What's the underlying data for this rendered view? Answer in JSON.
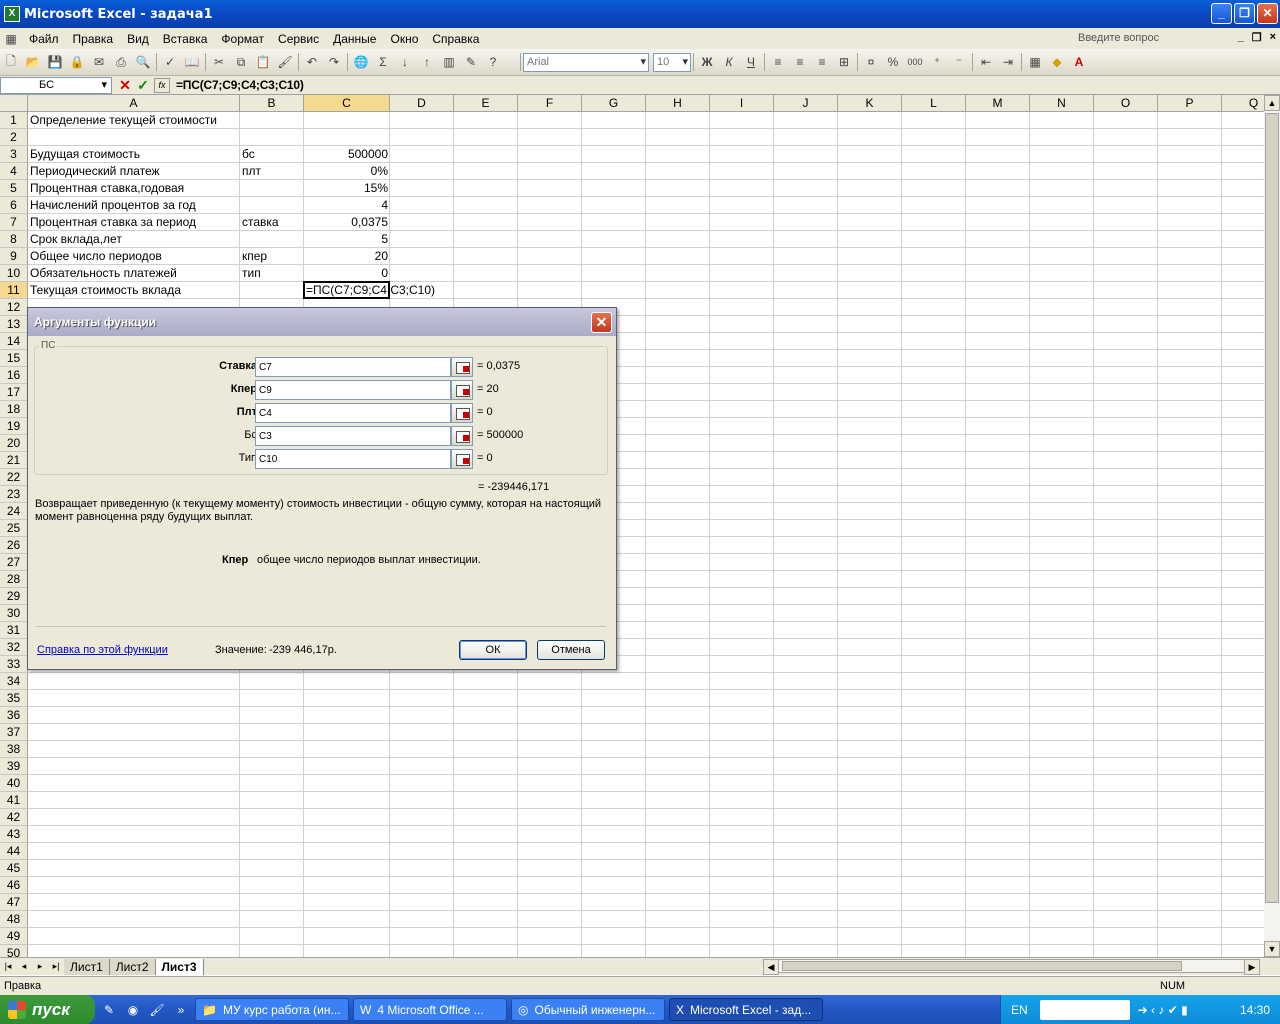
{
  "window": {
    "title": "Microsoft Excel - задача1",
    "minimize": "_",
    "maximize": "❐",
    "close": "✕"
  },
  "menu": {
    "items": [
      "Файл",
      "Правка",
      "Вид",
      "Вставка",
      "Формат",
      "Сервис",
      "Данные",
      "Окно",
      "Справка"
    ],
    "ask_placeholder": "Введите вопрос",
    "mdi": [
      "_",
      "❐",
      "×"
    ]
  },
  "toolbar": {
    "font": "Arial",
    "size": "10",
    "bold": "Ж",
    "italic": "К",
    "underline": "Ч",
    "percent": "%",
    "thousands": "000"
  },
  "formula_bar": {
    "name_box": "БС",
    "cancel": "✕",
    "enter": "✓",
    "fx": "fx",
    "formula": "=ПС(C7;C9;C4;C3;C10)"
  },
  "columns": [
    "A",
    "B",
    "C",
    "D",
    "E",
    "F",
    "G",
    "H",
    "I",
    "J",
    "K",
    "L",
    "M",
    "N",
    "O",
    "P",
    "Q"
  ],
  "rows": [
    "1",
    "2",
    "3",
    "4",
    "5",
    "6",
    "7",
    "8",
    "9",
    "10",
    "11",
    "12",
    "13",
    "14",
    "15",
    "16",
    "17",
    "18",
    "19",
    "20",
    "21",
    "22",
    "23",
    "24",
    "25",
    "26",
    "27",
    "28",
    "29",
    "30",
    "31",
    "32",
    "33",
    "34",
    "35",
    "36",
    "37",
    "38",
    "39",
    "40",
    "41",
    "42",
    "43",
    "44",
    "45",
    "46",
    "47",
    "48",
    "49",
    "50"
  ],
  "cells": {
    "A1": "Определение текущей стоимости",
    "A3": "Будущая стоимость",
    "B3": "бс",
    "C3": "500000",
    "A4": "Периодический платеж",
    "B4": "плт",
    "C4": "0%",
    "A5": "Процентная ставка,годовая",
    "C5": "15%",
    "A6": "Начислений процентов за год",
    "C6": "4",
    "A7": "Процентная ставка за период",
    "B7": "ставка",
    "C7": "0,0375",
    "A8": "Срок вклада,лет",
    "C8": "5",
    "A9": "Общее число периодов",
    "B9": "кпер",
    "C9": "20",
    "A10": "Обязательность платежей",
    "B10": "тип",
    "C10": "0",
    "A11": "Текущая стоимость вклада",
    "C11": "=ПС(C7;C9;C4;C3;C10)"
  },
  "dialog": {
    "title": "Аргументы функции",
    "group": "ПС",
    "args": [
      {
        "label": "Ставка",
        "bold": true,
        "value": "C7",
        "result": "= 0,0375"
      },
      {
        "label": "Кпер",
        "bold": true,
        "value": "C9",
        "result": "= 20"
      },
      {
        "label": "Плт",
        "bold": true,
        "value": "C4",
        "result": "= 0"
      },
      {
        "label": "Бс",
        "bold": false,
        "value": "C3",
        "result": "= 500000"
      },
      {
        "label": "Тип",
        "bold": false,
        "value": "C10",
        "result": "= 0"
      }
    ],
    "total": "= -239446,171",
    "description": "Возвращает приведенную (к текущему моменту) стоимость инвестиции - общую сумму, которая на настоящий момент равноценна ряду будущих выплат.",
    "arg_help_name": "Кпер",
    "arg_help_text": "общее число периодов выплат инвестиции.",
    "help_link": "Справка по этой функции",
    "value_label": "Значение:",
    "value": "-239 446,17р.",
    "ok": "ОК",
    "cancel": "Отмена"
  },
  "sheets": {
    "nav": [
      "|◂",
      "◂",
      "▸",
      "▸|"
    ],
    "tabs": [
      "Лист1",
      "Лист2",
      "Лист3"
    ],
    "active": 2
  },
  "status": {
    "left": "Правка",
    "num": "NUM"
  },
  "taskbar": {
    "start": "пуск",
    "buttons": [
      "МУ курс работа (ин...",
      "4 Microsoft Office ...",
      "Обычный инженерн...",
      "Microsoft Excel - зад..."
    ],
    "lang": "EN",
    "clock": "14:30"
  }
}
